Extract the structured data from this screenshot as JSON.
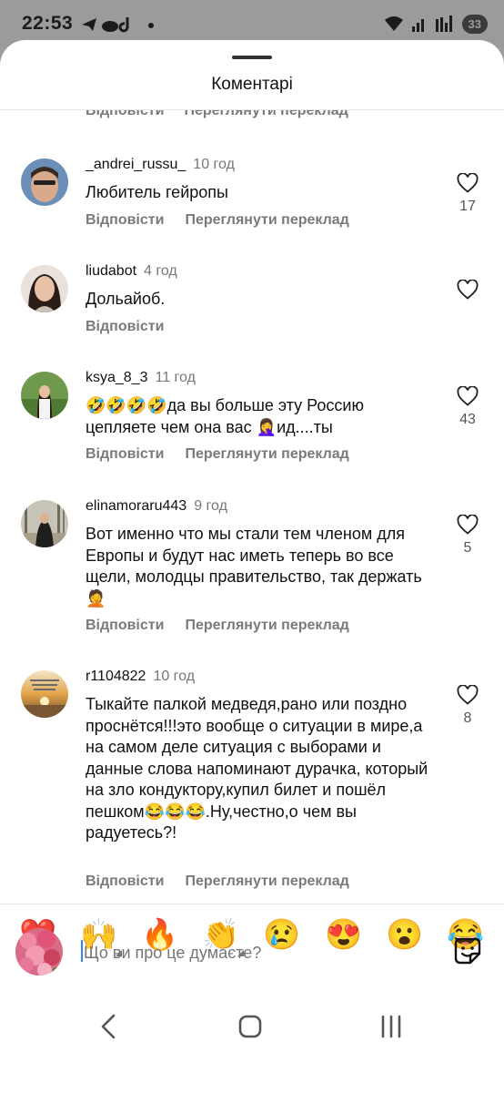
{
  "status": {
    "time": "22:53",
    "battery": "33"
  },
  "sheet": {
    "title": "Коментарі"
  },
  "partial_row": {
    "reply": "Відповісти",
    "translate": "Переглянути переклад"
  },
  "comments": [
    {
      "username": "_andrei_russu_",
      "time": "10 год",
      "text": "Любитель гейропы",
      "reply": "Відповісти",
      "translate": "Переглянути переклад",
      "likes": "17"
    },
    {
      "username": "liudabot",
      "time": "4 год",
      "text": "Дольайоб.",
      "reply": "Відповісти",
      "translate": "",
      "likes": ""
    },
    {
      "username": "ksya_8_3",
      "time": "11 год",
      "text": "🤣🤣🤣🤣да вы больше эту Россию цепляете чем она вас 🤦‍♀️ид....ты",
      "reply": "Відповісти",
      "translate": "Переглянути переклад",
      "likes": "43"
    },
    {
      "username": "elinamoraru443",
      "time": "9 год",
      "text": "Вот именно что мы стали тем членом для Европы и будут нас иметь теперь во все щели, молодцы правительство, так держать 🤦",
      "reply": "Відповісти",
      "translate": "Переглянути переклад",
      "likes": "5"
    },
    {
      "username": "r1104822",
      "time": "10 год",
      "text": "Тыкайте палкой медведя,рано или поздно проснётся!!!это вообще о ситуации в мире,а на самом деле ситуация с выборами и данные слова напоминают дурачка, который на зло кондуктору,купил билет и пошёл пешком😂😂😂.Ну,честно,о чем вы радуетесь?!",
      "reply": "Відповісти",
      "translate": "Переглянути переклад",
      "likes": "8"
    }
  ],
  "emoji_bar": [
    "❤️",
    "🙌",
    "🔥",
    "👏",
    "😢",
    "😍",
    "😮",
    "😂"
  ],
  "compose": {
    "placeholder": "Що ви про це думаєте?"
  }
}
